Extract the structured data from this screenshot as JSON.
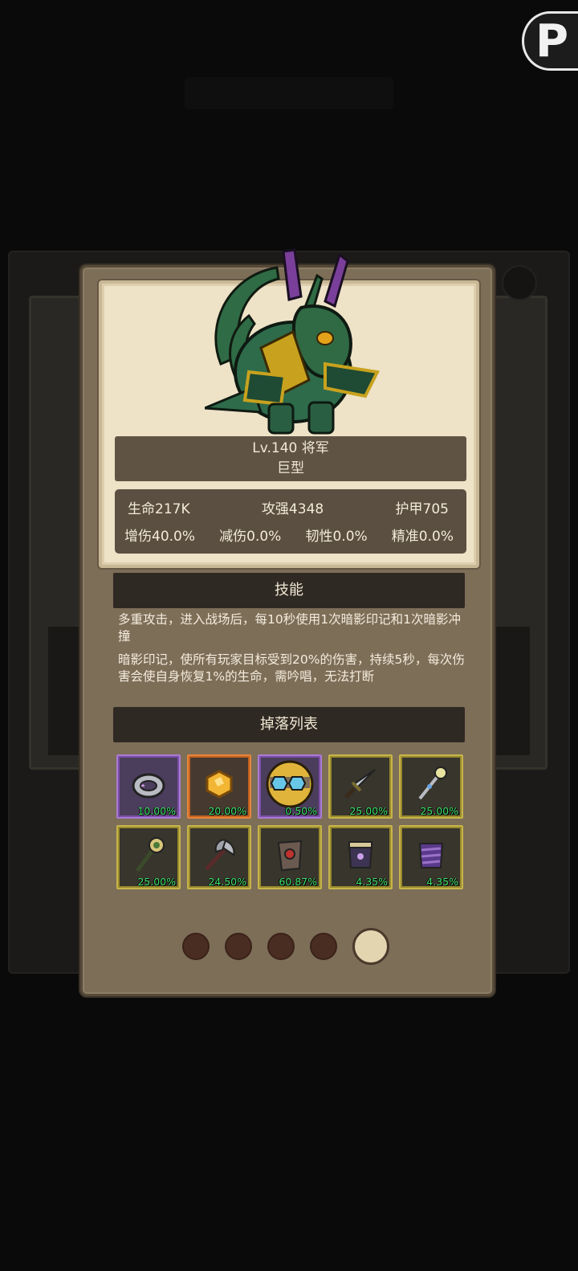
{
  "corner_logo": {
    "letter": "P"
  },
  "monster": {
    "level_name": "Lv.140 将军",
    "size_type": "巨型",
    "stats": [
      {
        "label": "生命217K"
      },
      {
        "label": "攻强4348"
      },
      {
        "label": "护甲705"
      },
      {
        "label": "增伤40.0%"
      },
      {
        "label": "减伤0.0%"
      },
      {
        "label": "韧性0.0%"
      },
      {
        "label": "精准0.0%"
      }
    ]
  },
  "skills": {
    "title": "技能",
    "items": [
      "多重攻击，进入战场后，每10秒使用1次暗影印记和1次暗影冲撞",
      "暗影印记，使所有玩家目标受到20%的伤害，持续5秒，每次伤害会使自身恢复1%的生命，需吟唱，无法打断"
    ]
  },
  "drops": {
    "title": "掉落列表",
    "items": [
      {
        "icon": "ring-icon",
        "rate": "10.00%",
        "quality": "purple"
      },
      {
        "icon": "gold-ore-icon",
        "rate": "20.00%",
        "quality": "orange"
      },
      {
        "icon": "mask-icon",
        "rate": "0.50%",
        "quality": "purple"
      },
      {
        "icon": "dagger-icon",
        "rate": "25.00%",
        "quality": "gold"
      },
      {
        "icon": "scepter-icon",
        "rate": "25.00%",
        "quality": "gold"
      },
      {
        "icon": "mace-icon",
        "rate": "25.00%",
        "quality": "gold"
      },
      {
        "icon": "axe-icon",
        "rate": "24.50%",
        "quality": "gold"
      },
      {
        "icon": "red-gem-chest-icon",
        "rate": "60.87%",
        "quality": "gold"
      },
      {
        "icon": "purple-chest-icon",
        "rate": "4.35%",
        "quality": "gold"
      },
      {
        "icon": "purple-armor-icon",
        "rate": "4.35%",
        "quality": "gold"
      }
    ]
  },
  "pager": {
    "count": 5,
    "active": 5
  }
}
